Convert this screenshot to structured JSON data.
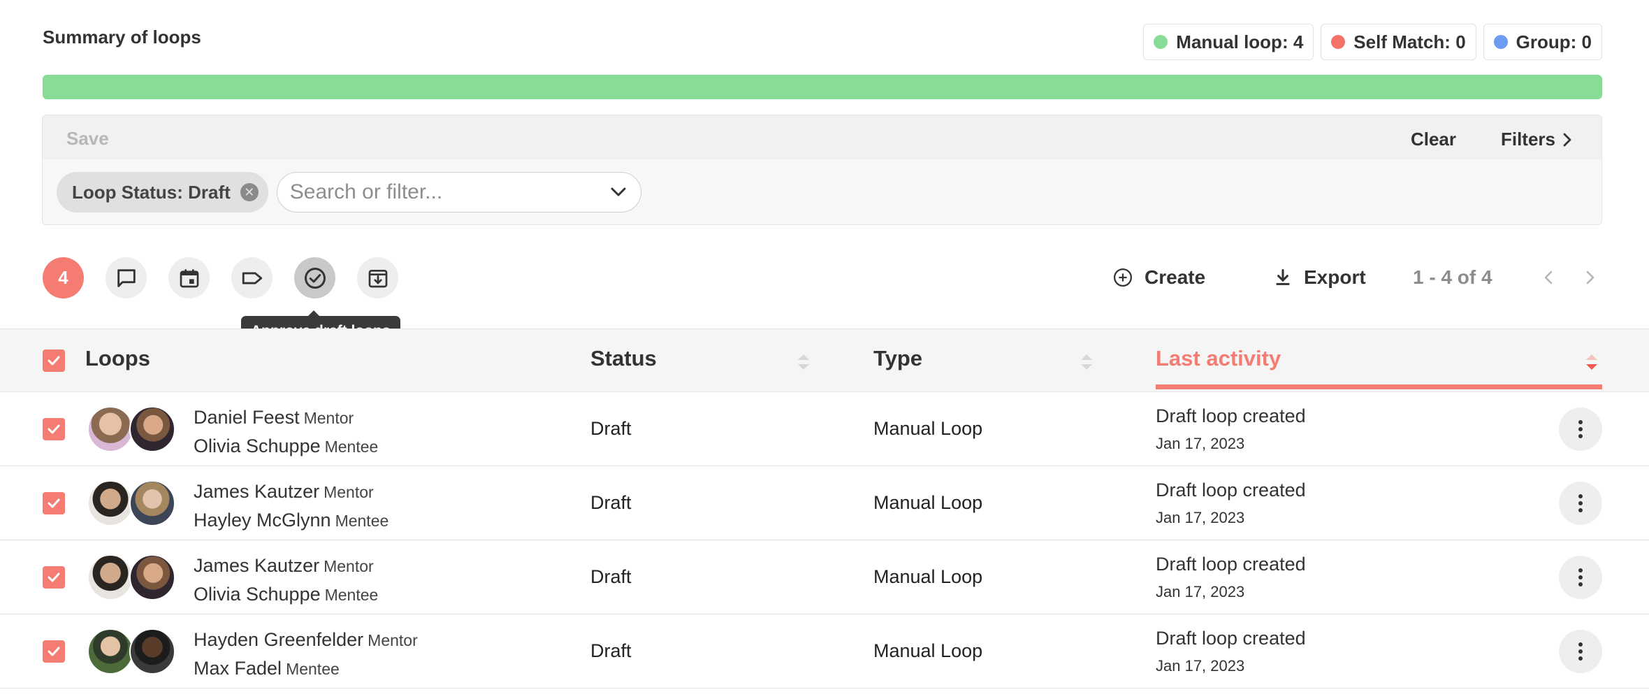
{
  "summary": {
    "title": "Summary of loops",
    "legend": [
      {
        "label": "Manual loop: 4",
        "color": "#88dc96"
      },
      {
        "label": "Self Match: 0",
        "color": "#f4726a"
      },
      {
        "label": "Group: 0",
        "color": "#6b9bf2"
      }
    ],
    "progress": {
      "manual_fraction": 1.0,
      "fill_color": "#88dc96"
    }
  },
  "filter_panel": {
    "save_label": "Save",
    "clear_label": "Clear",
    "filters_label": "Filters",
    "active_tag": "Loop Status: Draft",
    "search_placeholder": "Search or filter..."
  },
  "toolbar": {
    "selected_count": "4",
    "tools": [
      {
        "icon": "comment-icon"
      },
      {
        "icon": "calendar-icon"
      },
      {
        "icon": "tag-icon"
      },
      {
        "icon": "check-circle-icon"
      },
      {
        "icon": "archive-icon"
      }
    ],
    "tooltip": "Approve draft loops",
    "create_label": "Create",
    "export_label": "Export",
    "pagination": "1 - 4 of 4"
  },
  "table": {
    "columns": {
      "loops": "Loops",
      "status": "Status",
      "type": "Type",
      "last_activity": "Last activity"
    },
    "accent_color": "#f47c72",
    "rows": [
      {
        "mentor": "Daniel Feest",
        "mentor_role": "Mentor",
        "mentee": "Olivia Schuppe",
        "mentee_role": "Mentee",
        "status": "Draft",
        "type": "Manual Loop",
        "activity": "Draft loop created",
        "date": "Jan 17, 2023"
      },
      {
        "mentor": "James Kautzer",
        "mentor_role": "Mentor",
        "mentee": "Hayley McGlynn",
        "mentee_role": "Mentee",
        "status": "Draft",
        "type": "Manual Loop",
        "activity": "Draft loop created",
        "date": "Jan 17, 2023"
      },
      {
        "mentor": "James Kautzer",
        "mentor_role": "Mentor",
        "mentee": "Olivia Schuppe",
        "mentee_role": "Mentee",
        "status": "Draft",
        "type": "Manual Loop",
        "activity": "Draft loop created",
        "date": "Jan 17, 2023"
      },
      {
        "mentor": "Hayden Greenfelder",
        "mentor_role": "Mentor",
        "mentee": "Max Fadel",
        "mentee_role": "Mentee",
        "status": "Draft",
        "type": "Manual Loop",
        "activity": "Draft loop created",
        "date": "Jan 17, 2023"
      }
    ]
  }
}
